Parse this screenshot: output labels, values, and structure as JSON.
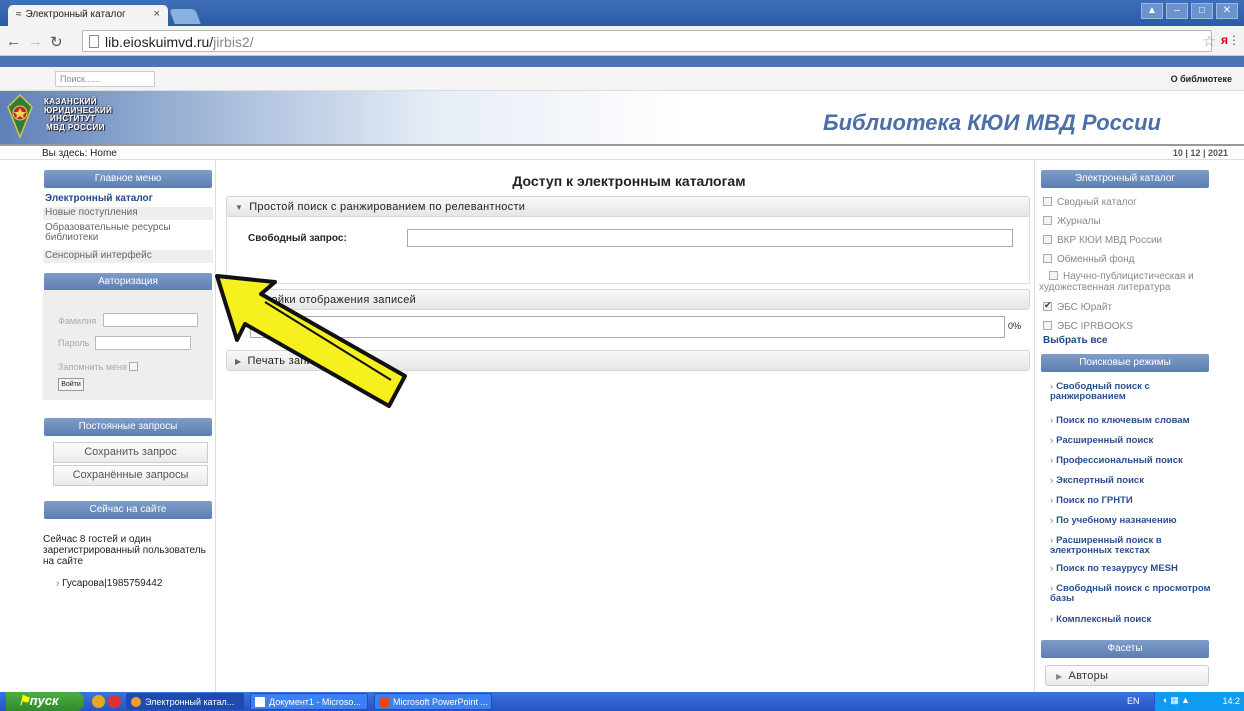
{
  "browser": {
    "tab_title": "Электронный каталог",
    "url_host": "lib.eioskuimvd.ru/",
    "url_path": "jirbis2/",
    "close_tab_glyph": "×"
  },
  "site": {
    "search_placeholder": "Поиск......",
    "about_link": "О библиотеке",
    "logo_lines": [
      "КАЗАНСКИЙ",
      "ЮРИДИЧЕСКИЙ",
      "ИНСТИТУТ",
      "МВД РОССИИ"
    ],
    "title": "Библиотека КЮИ МВД России",
    "breadcrumb": "Вы здесь: Home",
    "date": "10 | 12 | 2021"
  },
  "left": {
    "main_menu_title": "Главное меню",
    "menu": [
      "Электронный каталог",
      "Новые поступления",
      "Образовательные ресурсы библиотеки",
      "Сенсорный интерфейс"
    ],
    "auth_title": "Авторизация",
    "surname_label": "Фамилия",
    "password_label": "Пароль",
    "remember_label": "Запомнить меня",
    "login_button": "Войти",
    "saved_title": "Постоянные запросы",
    "save_query_button": "Сохранить запрос",
    "saved_queries_button": "Сохранённые запросы",
    "online_title": "Сейчас на сайте",
    "online_text": "Сейчас 8 гостей и один зарегистрированный пользователь на сайте",
    "online_user": "Гусарова|1985759442"
  },
  "main": {
    "title": "Доступ к электронным каталогам",
    "panel1_title": "Простой поиск с ранжированием по релевантности",
    "free_query_label": "Свободный запрос:",
    "free_query_value": "",
    "panel2_title": "ройки отображения записей",
    "progress_percent": 0,
    "progress_label": "0%",
    "panel3_title": "Печать запи"
  },
  "right": {
    "catalog_title": "Электронный каталог",
    "catalogs": [
      {
        "label": "Сводный каталог",
        "checked": false
      },
      {
        "label": "Журналы",
        "checked": false
      },
      {
        "label": "ВКР КЮИ МВД России",
        "checked": false
      },
      {
        "label": "Обменный фонд",
        "checked": false
      },
      {
        "label": "Научно-публицистическая и художественная литература",
        "checked": false
      },
      {
        "label": "ЭБС Юрайт",
        "checked": true
      },
      {
        "label": "ЭБС IPRBOOKS",
        "checked": false
      }
    ],
    "select_all": "Выбрать все",
    "modes_title": "Поисковые режимы",
    "modes": [
      "Свободный поиск с ранжированием",
      "Поиск по ключевым словам",
      "Расширенный поиск",
      "Профессиональный поиск",
      "Экспертный поиск",
      "Поиск по ГРНТИ",
      "По учебному назначению",
      "Расширенный поиск в электронных текстах",
      "Поиск по тезаурусу MESH",
      "Свободный поиск с просмотром базы",
      "Комплексный поиск"
    ],
    "facets_title": "Фасеты",
    "facet_authors": "Авторы"
  },
  "taskbar": {
    "start": "пуск",
    "items": [
      "Электронный катал...",
      "Документ1 - Microso...",
      "Microsoft PowerPoint ..."
    ],
    "lang": "EN",
    "clock": "14:2"
  },
  "colors": {
    "accent_blue": "#5c7db4",
    "link_blue": "#1f4a8a",
    "annotation_arrow": "#f5f01e"
  }
}
